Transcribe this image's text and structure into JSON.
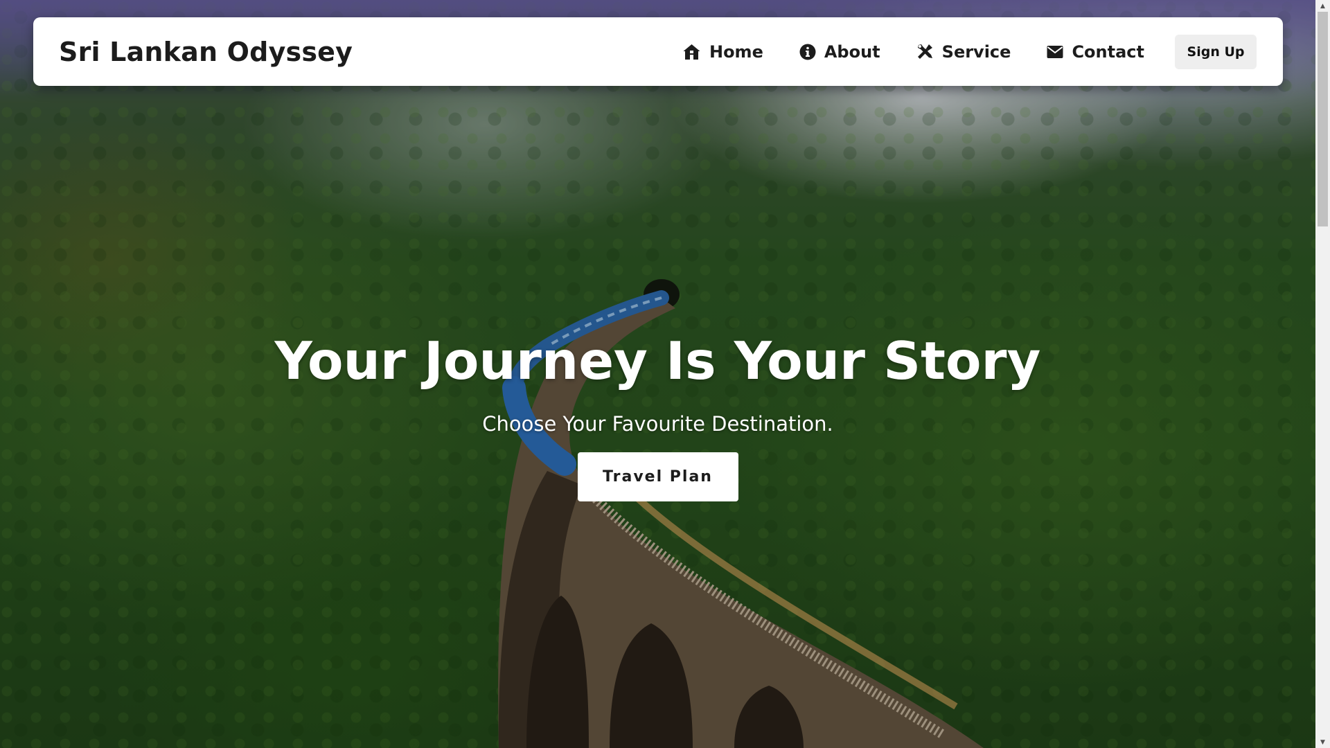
{
  "navbar": {
    "brand": "Sri Lankan Odyssey",
    "links": [
      {
        "label": "Home",
        "icon": "home-icon"
      },
      {
        "label": "About",
        "icon": "info-icon"
      },
      {
        "label": "Service",
        "icon": "tools-icon"
      },
      {
        "label": "Contact",
        "icon": "envelope-icon"
      }
    ],
    "signup_label": "Sign Up"
  },
  "hero": {
    "title": "Your Journey Is Your Story",
    "subtitle": "Choose Your Favourite Destination.",
    "cta_label": "Travel Plan",
    "background": "forest-railway-bridge-photo"
  },
  "colors": {
    "navbar_bg": "#ffffff",
    "text_dark": "#1c1c1c",
    "signup_bg": "#eeeeee",
    "hero_text": "#ffffff"
  }
}
